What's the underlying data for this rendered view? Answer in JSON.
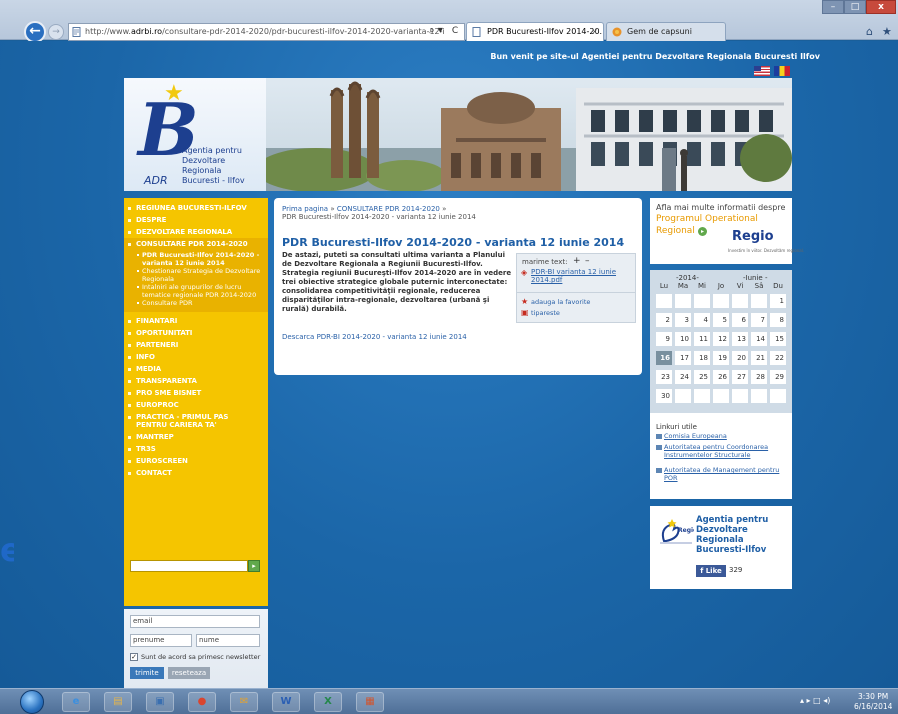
{
  "browser": {
    "url_prefix": "http://www.",
    "url_host": "adrbi.ro",
    "url_rest": "/consultare-pdr-2014-2020/pdr-bucuresti-ilfov-2014-2020-varianta-12-i",
    "search_symbol": "⌕ ▾",
    "refresh_symbol": "C",
    "tabs": [
      {
        "label": "PDR Bucuresti-Ilfov 2014-20...",
        "close": "×",
        "active": true
      },
      {
        "label": "Gem de capsuni",
        "active": false
      }
    ],
    "window_controls": {
      "minimize": "–",
      "maximize": "□",
      "close": "x"
    },
    "home_symbol": "⌂",
    "favorites_symbol": "★"
  },
  "header": {
    "welcome": "Bun venit pe site-ul Agentiei pentru Dezvoltare Regionala Bucuresti Ilfov",
    "logo": {
      "mark": "B",
      "name_lines": [
        "Agentia pentru",
        "Dezvoltare Regionala",
        "Bucuresti - Ilfov"
      ],
      "abbr": "ADR"
    }
  },
  "sidebar": {
    "menu": [
      {
        "label": "REGIUNEA BUCURESTI-ILFOV"
      },
      {
        "label": "DESPRE"
      },
      {
        "label": "DEZVOLTARE REGIONALA"
      },
      {
        "label": "CONSULTARE PDR 2014-2020",
        "active": true
      }
    ],
    "submenu": [
      "PDR Bucuresti-Ilfov 2014-2020 - varianta 12 iunie 2014",
      "Chestionare Strategia de Dezvoltare Regionala",
      "Intalniri ale grupurilor de lucru tematice regionale PDR 2014-2020",
      "Consultare PDR"
    ],
    "menu_after": [
      "FINANTARI",
      "OPORTUNITATI",
      "PARTENERI",
      "INFO",
      "MEDIA",
      "TRANSPARENTA",
      "PRO SME BISNET",
      "EUROPROC",
      "PRACTICA - PRIMUL PAS PENTRU CARIERA TA'",
      "MANTREP",
      "TR3S",
      "EUROSCREEN",
      "CONTACT"
    ],
    "search_button": "▸"
  },
  "newsletter": {
    "email": "email",
    "prenume": "prenume",
    "nume": "nume",
    "agree_check": "✓",
    "agree_label": "Sunt de acord sa primesc newsletter",
    "submit": "trimite",
    "reset": "reseteaza"
  },
  "main": {
    "breadcrumb": {
      "home": "Prima pagina",
      "sep": " » ",
      "section": "CONSULTARE PDR 2014-2020",
      "current": "PDR Bucuresti-Ilfov 2014-2020 - varianta 12 iunie 2014"
    },
    "title": "PDR Bucuresti-Ilfov 2014-2020 - varianta 12 iunie 2014",
    "lead": "De astazi, puteti sa consultati ultima varianta a Planului de Dezvoltare Regionala a Regiunii Bucuresti-Ilfov. Strategia regiunii Bucureşti-Ilfov 2014-2020 are în vedere trei obiective strategice globale puternic interconectate: consolidarea competitivităţii regionale, reducerea disparităţilor intra-regionale, dezvoltarea (urbană şi rurală) durabilă.",
    "download": "Descarca PDR-BI 2014-2020 - varianta 12 iunie 2014",
    "tools": {
      "text_size_label": "marime text:",
      "plus": "+",
      "minus": "–",
      "pdf_link": "PDR-BI varianta 12 iunie 2014.pdf",
      "favorites": "adauga la favorite",
      "print": "tipareste"
    }
  },
  "regio": {
    "line1": "Afla mai multe informatii despre",
    "line2": "Programul Operational",
    "line3": "Regional",
    "go": "▸",
    "logo": "Regio",
    "tagline": "Investim în viitor. Dezvoltăm regional."
  },
  "calendar": {
    "year": "-2014-",
    "month": "-Iunie -",
    "weekdays": [
      "Lu",
      "Ma",
      "Mi",
      "Jo",
      "Vi",
      "Sâ",
      "Du"
    ],
    "weeks": [
      [
        "",
        "",
        "",
        "",
        "",
        "",
        "1"
      ],
      [
        "2",
        "3",
        "4",
        "5",
        "6",
        "7",
        "8"
      ],
      [
        "9",
        "10",
        "11",
        "12",
        "13",
        "14",
        "15"
      ],
      [
        "16",
        "17",
        "18",
        "19",
        "20",
        "21",
        "22"
      ],
      [
        "23",
        "24",
        "25",
        "26",
        "27",
        "28",
        "29"
      ],
      [
        "30",
        "",
        "",
        "",
        "",
        "",
        ""
      ]
    ],
    "today": "16"
  },
  "links": {
    "title": "Linkuri utile",
    "items": [
      "Comisia Europeana",
      "Autoritatea pentru Coordonarea Instrumentelor Structurale",
      "Autoritatea de Management pentru POR"
    ]
  },
  "facebook": {
    "name": "Agentia pentru Dezvoltare Regionala Bucuresti-Ilfov",
    "like": "Like",
    "count": "329"
  },
  "stray_letter": "e",
  "taskbar": {
    "icons": [
      "e",
      "▤",
      "▣",
      "●",
      "✉",
      "W",
      "X",
      "▦"
    ],
    "tray": "▴  ▸ □ ◂)",
    "time": "3:30 PM",
    "date": "6/16/2014"
  }
}
